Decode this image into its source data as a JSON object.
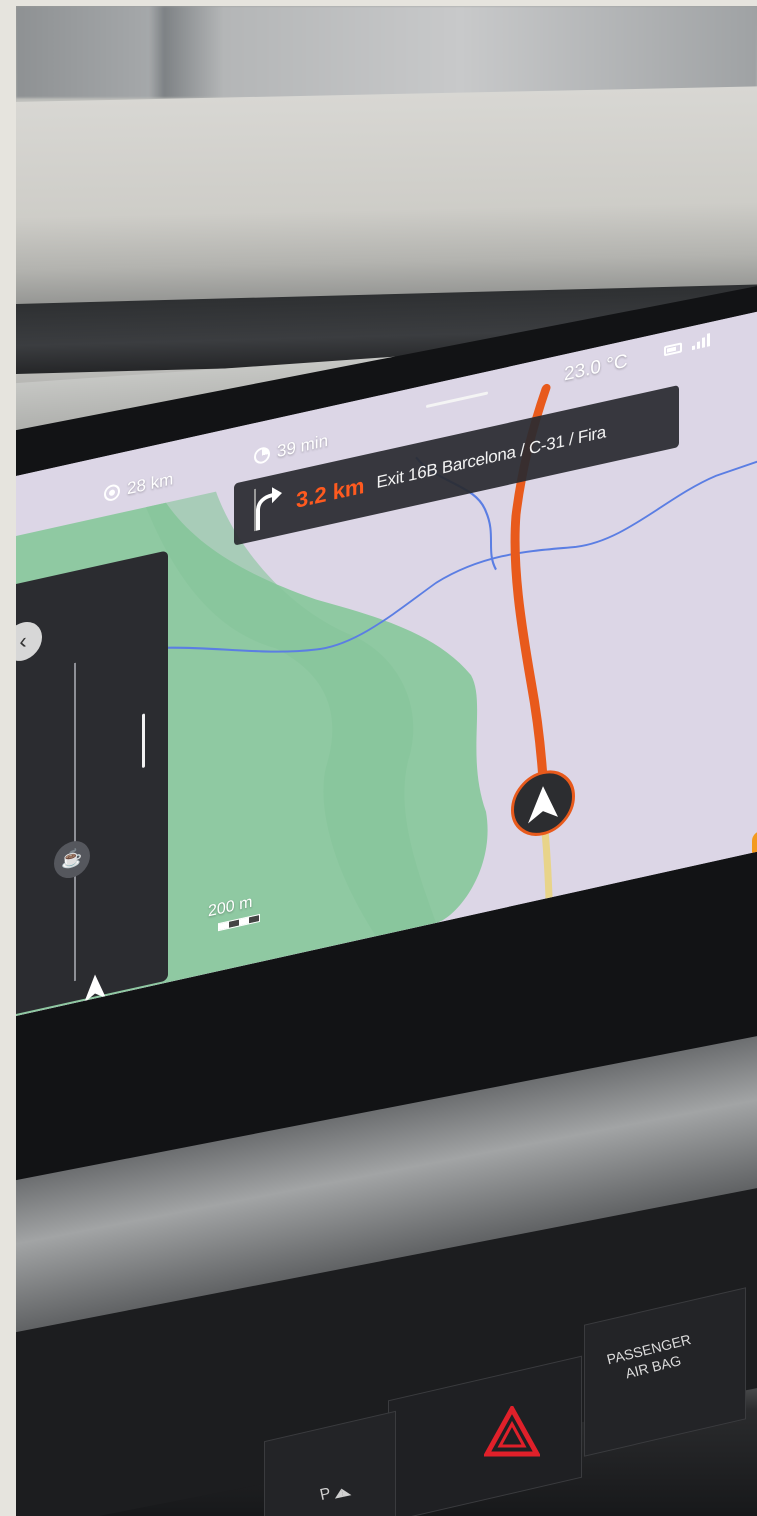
{
  "status": {
    "distance_remaining": "28 km",
    "time_remaining": "39 min",
    "temperature": "23.0 °C"
  },
  "guidance": {
    "distance_to_turn": "3.2 km",
    "exit_label": "Exit 16B Barcelona / C-31 / Fira"
  },
  "map": {
    "scale_label": "200 m"
  },
  "dock": {
    "menu_label": "///"
  },
  "console": {
    "passenger_airbag": "PASSENGER\nAIR BAG",
    "park_assist_label": "P"
  },
  "colors": {
    "route": "#e85a1c",
    "accent": "#ff5a1f",
    "nav_app": "#1467d4",
    "phone_app": "#8fc31f",
    "media_app": "#6b2fbe"
  }
}
